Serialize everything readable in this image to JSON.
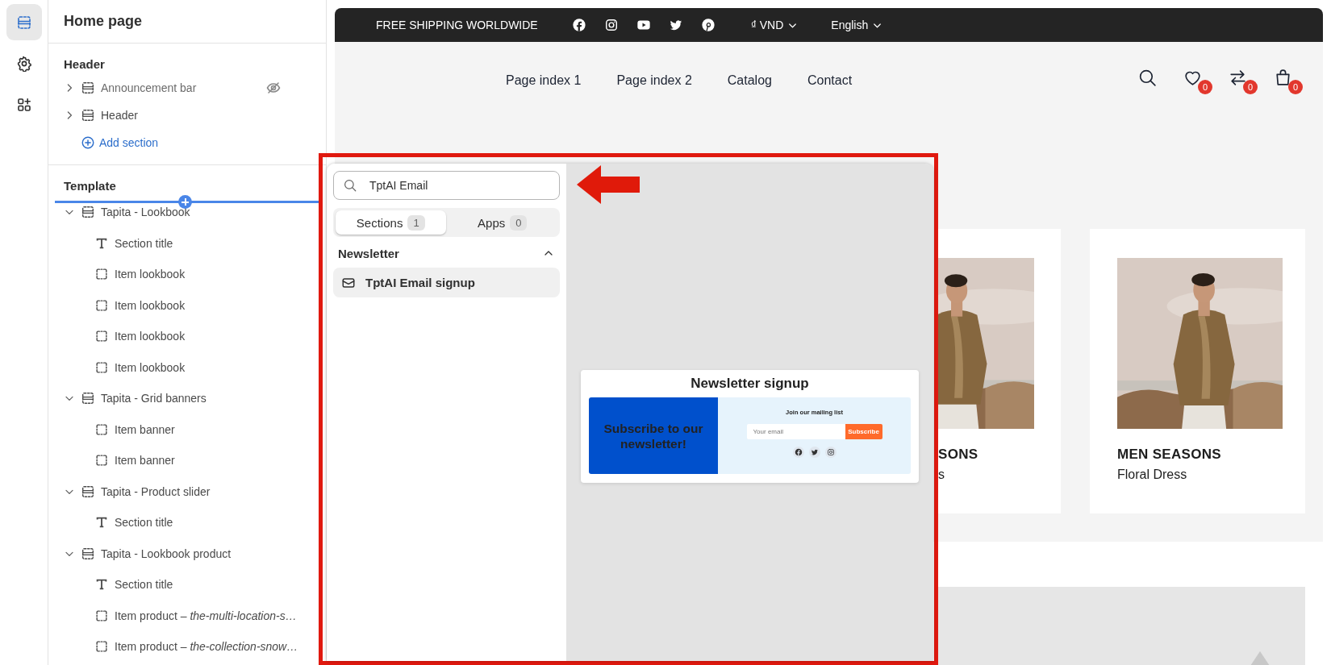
{
  "rail": [
    {
      "kind": "sections",
      "selected": true
    },
    {
      "kind": "settings",
      "selected": false
    },
    {
      "kind": "apps",
      "selected": false
    }
  ],
  "sidebar": {
    "title": "Home page",
    "groups": [
      {
        "heading": "Header",
        "add_label": "Add section",
        "items": [
          {
            "label": "Announcement bar",
            "kind": "section",
            "expanded": false,
            "hidden": true
          },
          {
            "label": "Header",
            "kind": "section",
            "expanded": false,
            "hidden": false
          }
        ]
      },
      {
        "heading": "Template",
        "insert_indicator": true,
        "items": [
          {
            "label": "Tapita - Lookbook",
            "kind": "section",
            "expanded": true,
            "hidden": false,
            "children": [
              {
                "label": "Section title",
                "kind": "text"
              },
              {
                "label": "Item lookbook",
                "kind": "block"
              },
              {
                "label": "Item lookbook",
                "kind": "block"
              },
              {
                "label": "Item lookbook",
                "kind": "block"
              },
              {
                "label": "Item lookbook",
                "kind": "block"
              }
            ]
          },
          {
            "label": "Tapita - Grid banners",
            "kind": "section",
            "expanded": true,
            "hidden": false,
            "children": [
              {
                "label": "Item banner",
                "kind": "block"
              },
              {
                "label": "Item banner",
                "kind": "block"
              }
            ]
          },
          {
            "label": "Tapita - Product slider",
            "kind": "section",
            "expanded": true,
            "hidden": false,
            "children": [
              {
                "label": "Section title",
                "kind": "text"
              }
            ]
          },
          {
            "label": "Tapita - Lookbook product",
            "kind": "section",
            "expanded": true,
            "hidden": false,
            "children": [
              {
                "label": "Section title",
                "kind": "text"
              },
              {
                "label": "Item product – *the-multi-location-s…*",
                "kind": "block"
              },
              {
                "label": "Item product – *the-collection-snow…*",
                "kind": "block"
              }
            ]
          }
        ]
      }
    ]
  },
  "store": {
    "announcement": "FREE SHIPPING WORLDWIDE",
    "currency": "₫ VND",
    "language": "English",
    "nav": [
      "Page index 1",
      "Page index 2",
      "Catalog",
      "Contact"
    ],
    "actions": [
      {
        "kind": "search"
      },
      {
        "kind": "wishlist",
        "count": "0"
      },
      {
        "kind": "compare",
        "count": "0"
      },
      {
        "kind": "cart",
        "count": "0"
      }
    ],
    "cards": [
      {
        "kind": "picture",
        "title": "SONS",
        "subtitle": "s"
      },
      {
        "kind": "picture",
        "title": "MEN SEASONS",
        "subtitle": "Floral Dress"
      }
    ]
  },
  "popup": {
    "search": {
      "value": "TptAI Email"
    },
    "tabs": [
      {
        "label": "Sections",
        "count": "1",
        "selected": true
      },
      {
        "label": "Apps",
        "count": "0",
        "selected": false
      }
    ],
    "category": {
      "label": "Newsletter",
      "expanded": true,
      "items": [
        {
          "label": "TptAI Email signup",
          "selected": true
        }
      ]
    },
    "preview": {
      "title": "Newsletter signup",
      "banner": "Subscribe to our newsletter!",
      "heading": "Join our mailing list",
      "placeholder": "Your email",
      "button": "Subscribe"
    }
  }
}
